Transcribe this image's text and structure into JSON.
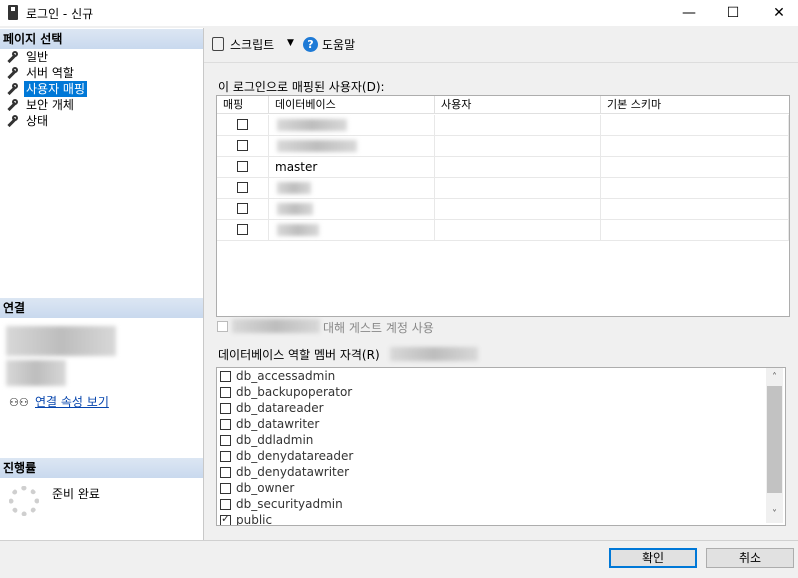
{
  "window": {
    "title": "로그인 - 신규",
    "minimize": "—",
    "maximize": "☐",
    "close": "✕"
  },
  "left": {
    "page_select_header": "페이지 선택",
    "nav": [
      "일반",
      "서버 역할",
      "사용자 매핑",
      "보안 개체",
      "상태"
    ],
    "selected_nav": "사용자 매핑",
    "connection_header": "연결",
    "connection_link": "연결 속성 보기",
    "progress_header": "진행률",
    "progress_status": "준비 완료"
  },
  "toolbar": {
    "script_label": "스크립트",
    "help_label": "도움말",
    "icons": [
      "script-icon",
      "help-icon"
    ]
  },
  "mapping": {
    "title": "이 로그인으로 매핑된 사용자(D):",
    "columns": [
      "매핑",
      "데이터베이스",
      "사용자",
      "기본 스키마"
    ],
    "rows": [
      {
        "mapped": false,
        "database": ""
      },
      {
        "mapped": false,
        "database": ""
      },
      {
        "mapped": false,
        "database": "master"
      },
      {
        "mapped": false,
        "database": ""
      },
      {
        "mapped": false,
        "database": ""
      },
      {
        "mapped": false,
        "database": ""
      }
    ]
  },
  "guest_label": "대해 게스트 계정 사용",
  "roles": {
    "title": "데이터베이스 역할 멤버 자격(R)",
    "items": [
      {
        "name": "db_accessadmin",
        "checked": false
      },
      {
        "name": "db_backupoperator",
        "checked": false
      },
      {
        "name": "db_datareader",
        "checked": false
      },
      {
        "name": "db_datawriter",
        "checked": false
      },
      {
        "name": "db_ddladmin",
        "checked": false
      },
      {
        "name": "db_denydatareader",
        "checked": false
      },
      {
        "name": "db_denydatawriter",
        "checked": false
      },
      {
        "name": "db_owner",
        "checked": false
      },
      {
        "name": "db_securityadmin",
        "checked": false
      },
      {
        "name": "public",
        "checked": true
      }
    ],
    "scroll_up": "˄",
    "scroll_down": "˅"
  },
  "buttons": {
    "ok": "확인",
    "cancel": "취소"
  },
  "colors": {
    "selection": "#0078d7",
    "link": "#0645ad",
    "header_bg": "#c9d9ee"
  }
}
